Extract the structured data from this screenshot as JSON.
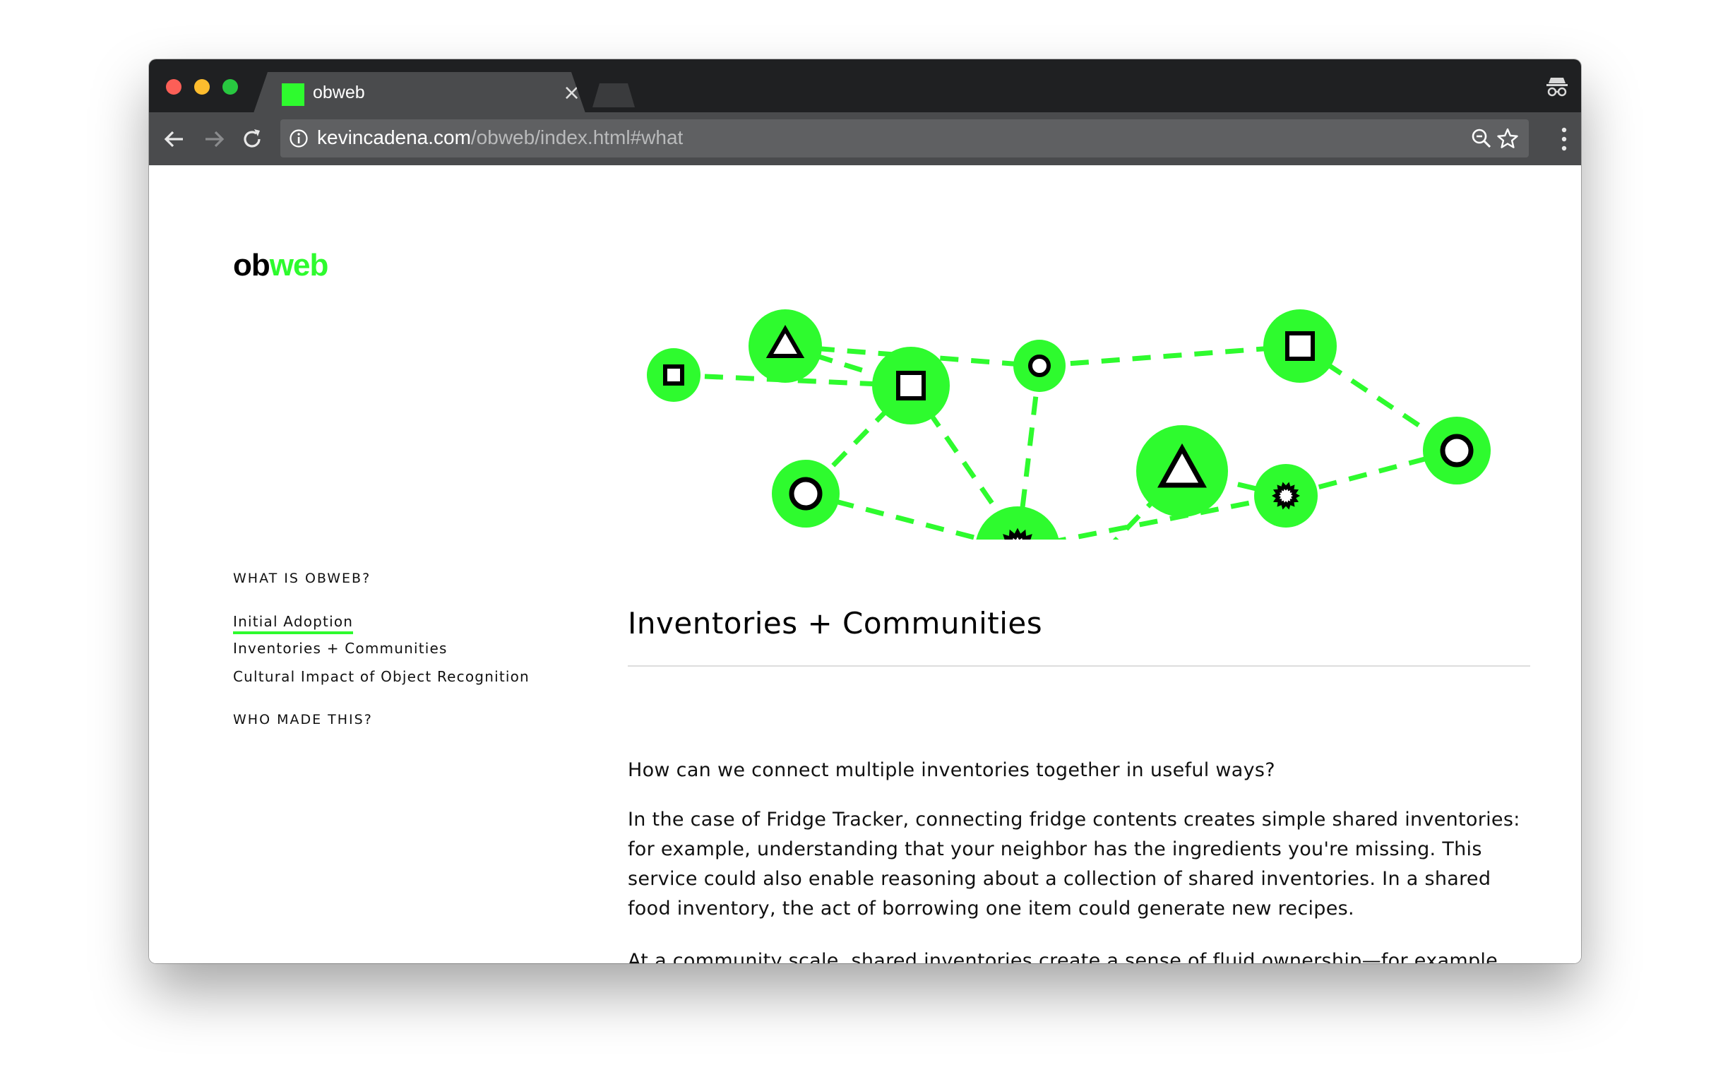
{
  "browser": {
    "tab_title": "obweb",
    "tab_close": "×",
    "url_domain": "kevincadena.com",
    "url_path": "/obweb/index.html#what"
  },
  "site": {
    "logo_part1": "ob",
    "logo_part2": "web",
    "accent_color": "#2efb2e"
  },
  "nav": {
    "heading_what": "WHAT IS OBWEB?",
    "links": [
      {
        "label": "Initial Adoption",
        "active": true
      },
      {
        "label": "Inventories + Communities",
        "active": false
      },
      {
        "label": "Cultural Impact of Object Recognition",
        "active": false
      }
    ],
    "heading_who": "WHO MADE THIS?"
  },
  "main": {
    "title": "Inventories + Communities",
    "paragraphs": [
      "How can we connect multiple inventories together in useful ways?",
      "In the case of Fridge Tracker, connecting fridge contents creates simple shared inventories: for example, understanding that your neighbor has the ingredients you're missing. This service could also enable reasoning about a collection of shared inventories. In a shared food inventory, the act of borrowing one item could generate new recipes.",
      "At a community scale, shared inventories create a sense of fluid ownership—for example"
    ]
  },
  "illustration": {
    "node_shapes": [
      "square",
      "triangle",
      "square",
      "circle",
      "triangle",
      "square",
      "circle",
      "starburst",
      "circle",
      "starburst"
    ]
  }
}
